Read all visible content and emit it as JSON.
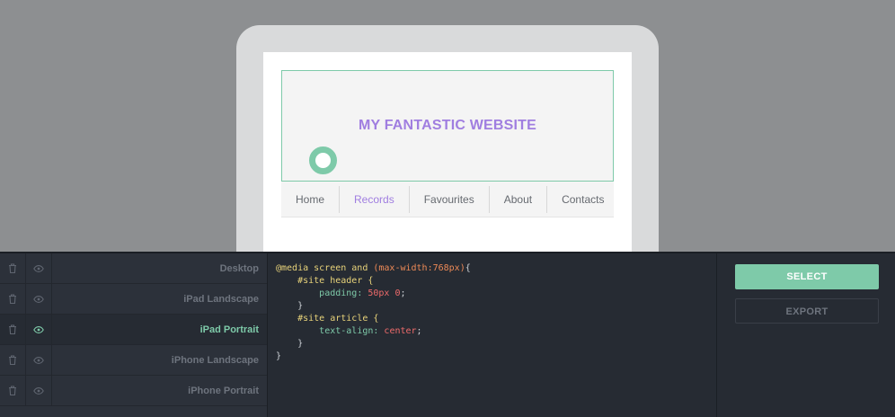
{
  "preview": {
    "site_title": "MY FANTASTIC WEBSITE",
    "nav": [
      {
        "label": "Home",
        "active": false
      },
      {
        "label": "Records",
        "active": true
      },
      {
        "label": "Favourites",
        "active": false
      },
      {
        "label": "About",
        "active": false
      },
      {
        "label": "Contacts",
        "active": false
      }
    ]
  },
  "breakpoints": [
    {
      "label": "Desktop",
      "active": false
    },
    {
      "label": "iPad Landscape",
      "active": false
    },
    {
      "label": "iPad Portrait",
      "active": true
    },
    {
      "label": "iPhone Landscape",
      "active": false
    },
    {
      "label": "iPhone Portrait",
      "active": false
    }
  ],
  "code": {
    "l1_at": "@media screen and ",
    "l1_paren": "(max-width:768px)",
    "l1_brace": "{",
    "l2_sel": "#site header {",
    "l3_prop": "padding: ",
    "l3_val": "50px 0",
    "l3_end": ";",
    "l4": "}",
    "l5_sel": "#site article {",
    "l6_prop": "text-align: ",
    "l6_val": "center",
    "l6_end": ";",
    "l7": "}",
    "l8": "}"
  },
  "actions": {
    "select_label": "SELECT",
    "export_label": "EXPORT"
  },
  "colors": {
    "accent": "#7ecaa9",
    "title_purple": "#a07ee0",
    "panel_bg": "#262b33"
  },
  "icons": {
    "row_delete": "trash-icon",
    "row_visibility": "eye-icon"
  }
}
